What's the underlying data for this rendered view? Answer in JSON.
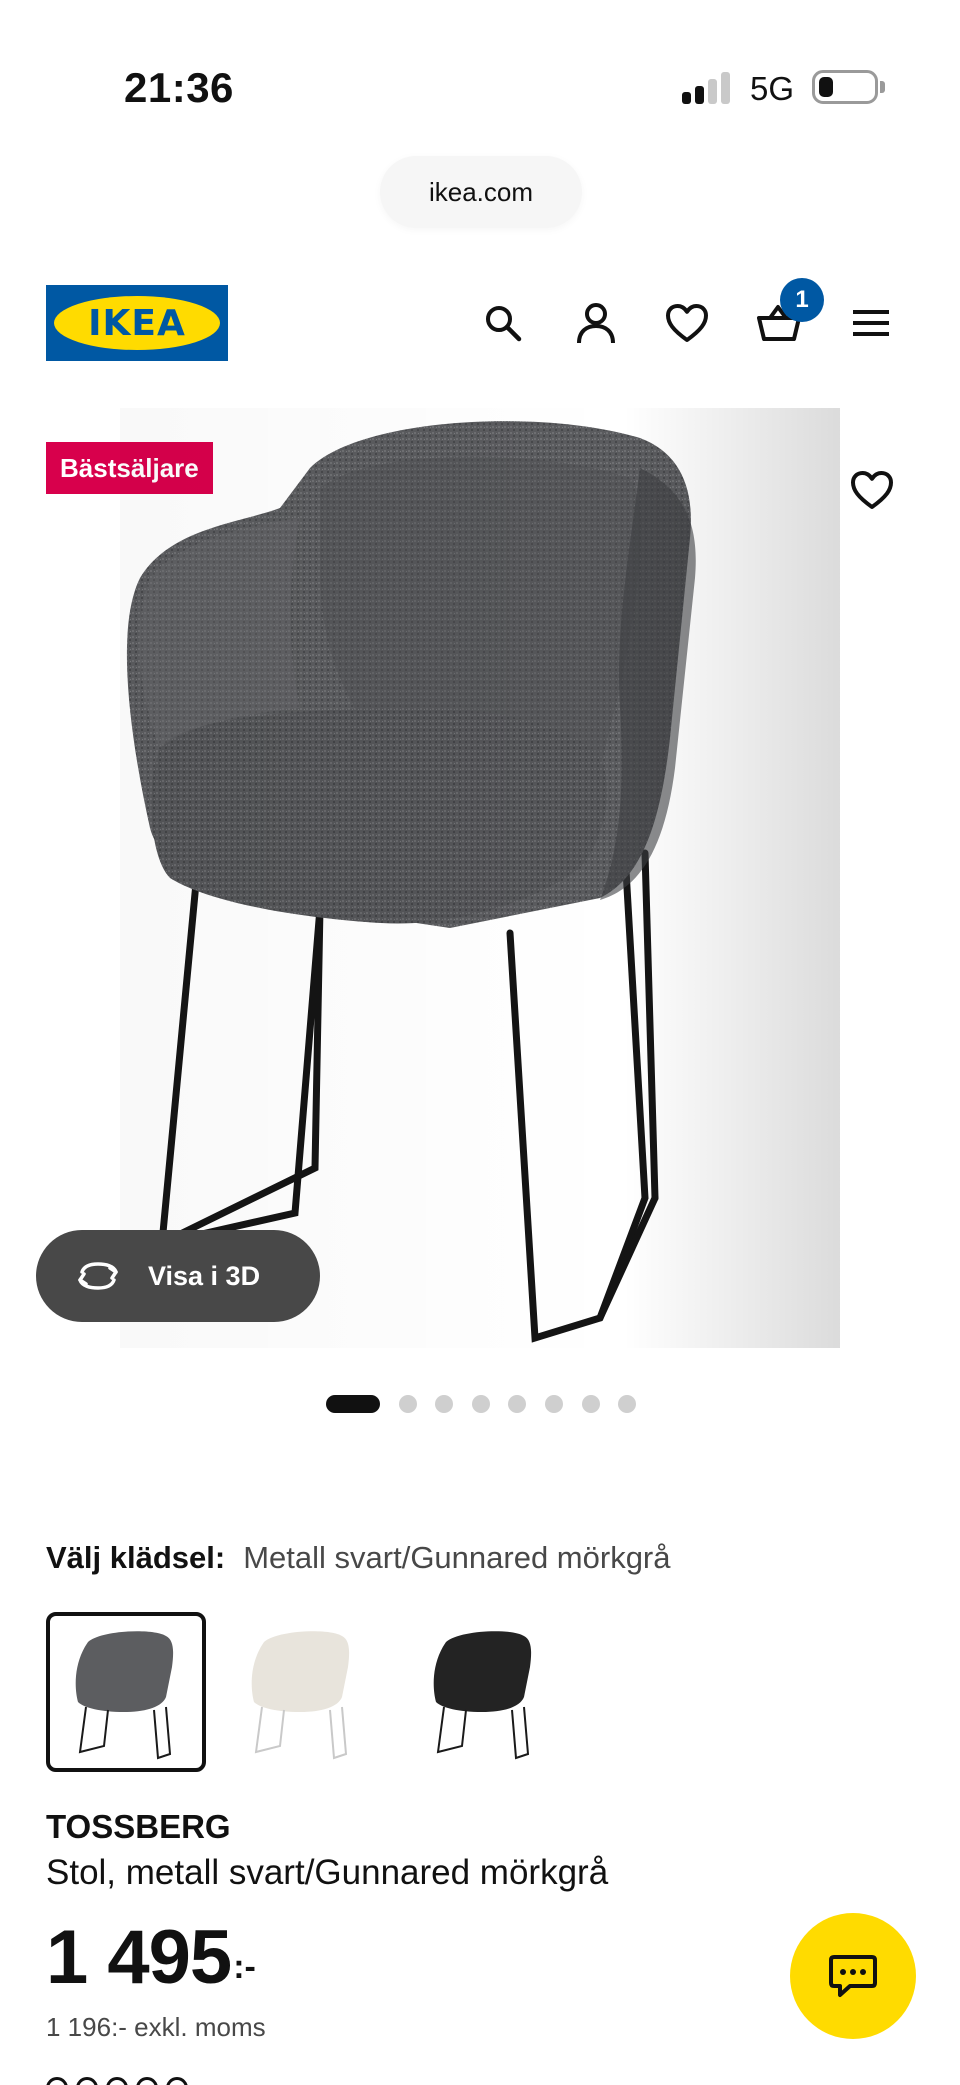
{
  "status_bar": {
    "time": "21:36",
    "network": "5G"
  },
  "browser": {
    "url": "ikea.com"
  },
  "header": {
    "logo_text": "IKEA",
    "cart_count": "1"
  },
  "product": {
    "badge": "Bästsäljare",
    "view_3d_label": "Visa i 3D",
    "image_dots": {
      "total": 8,
      "active_index": 0
    },
    "upholstery_label": "Välj klädsel:",
    "upholstery_value": "Metall svart/Gunnared mörkgrå",
    "swatches": [
      {
        "name": "Metall svart/Gunnared mörkgrå",
        "seat_color": "#5c5d60",
        "frame_color": "#1a1a1a",
        "selected": true
      },
      {
        "name": "ljus",
        "seat_color": "#e8e4dc",
        "frame_color": "#c9c9c9",
        "selected": false
      },
      {
        "name": "svart",
        "seat_color": "#232323",
        "frame_color": "#1a1a1a",
        "selected": false
      }
    ],
    "name": "TOSSBERG",
    "description": "Stol, metall svart/Gunnared mörkgrå",
    "price": "1 495",
    "price_suffix": ":-",
    "price_excl_vat": "1 196:- exkl. moms"
  },
  "colors": {
    "ikea_blue": "#0058a3",
    "ikea_yellow": "#ffdb00",
    "badge_red": "#d8004c",
    "text_dark": "#111111",
    "text_muted": "#484848"
  },
  "icons": [
    "search-icon",
    "profile-icon",
    "heart-icon",
    "cart-icon",
    "menu-icon",
    "rotate-3d-icon",
    "chat-icon"
  ]
}
